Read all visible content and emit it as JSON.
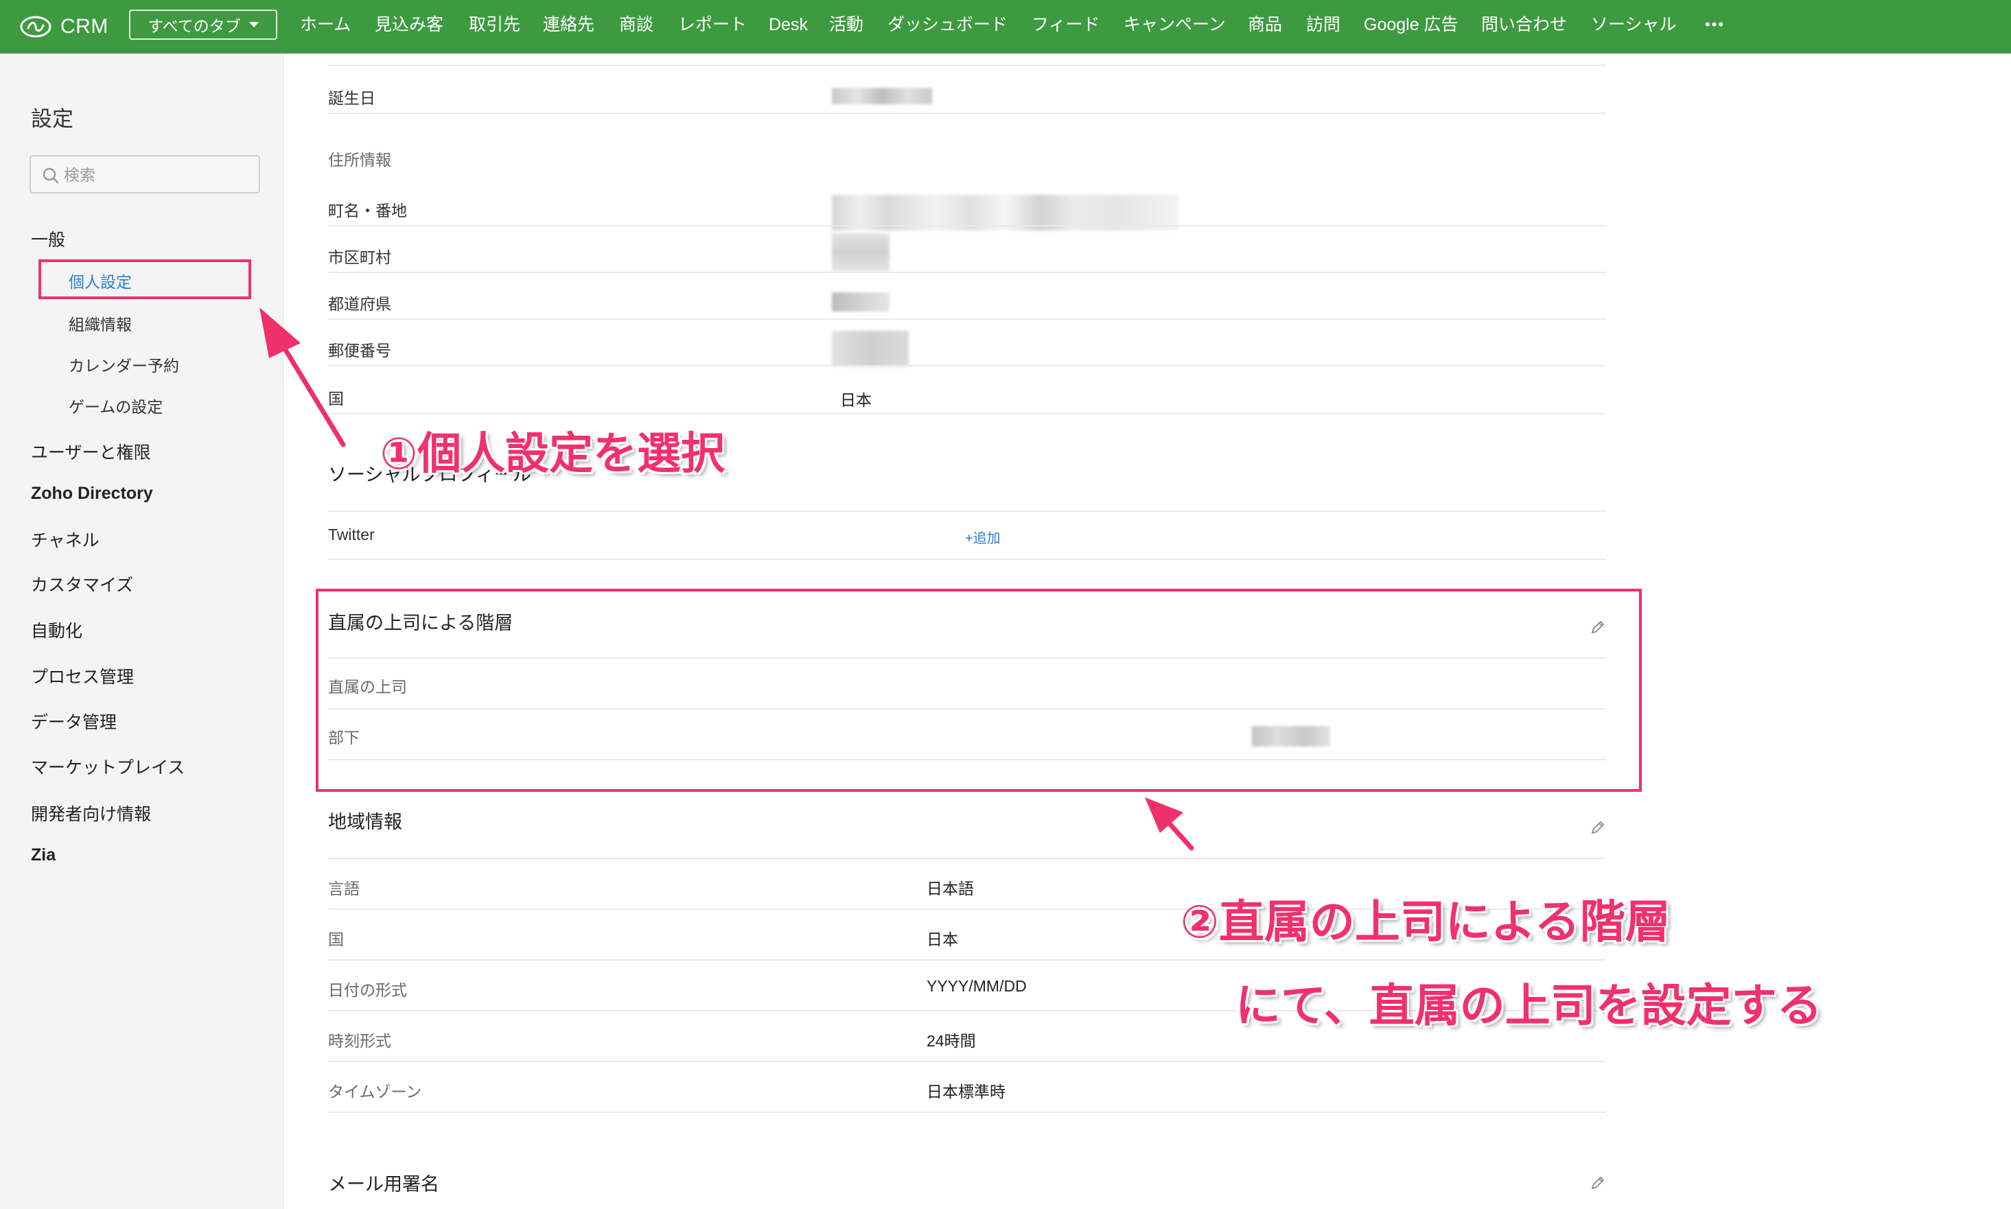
{
  "topbar": {
    "app_name": "CRM",
    "tab_selector": "すべてのタブ",
    "nav_items": [
      "ホーム",
      "見込み客",
      "取引先",
      "連絡先",
      "商談",
      "レポート",
      "Desk",
      "活動",
      "ダッシュボード",
      "フィード",
      "キャンペーン",
      "商品",
      "訪問",
      "Google 広告",
      "問い合わせ",
      "ソーシャル",
      "•••"
    ],
    "bar_color": "#3e9a40"
  },
  "sidebar": {
    "title": "設定",
    "search_placeholder": "検索",
    "general": "一般",
    "general_items": [
      "個人設定",
      "組織情報",
      "カレンダー予約",
      "ゲームの設定"
    ],
    "active_item": "個人設定",
    "sections": [
      "ユーザーと権限",
      "Zoho Directory",
      "チャネル",
      "カスタマイズ",
      "自動化",
      "プロセス管理",
      "データ管理",
      "マーケットプレイス",
      "開発者向け情報",
      "Zia"
    ]
  },
  "profile": {
    "birthday_label": "誕生日",
    "address_header": "住所情報",
    "street_label": "町名・番地",
    "city_label": "市区町村",
    "prefecture_label": "都道府県",
    "postal_label": "郵便番号",
    "country_label": "国",
    "country_value": "日本",
    "social_header": "ソーシャルプロフィール",
    "twitter_label": "Twitter",
    "add_link": "+追加"
  },
  "hierarchy": {
    "header": "直属の上司による階層",
    "manager_label": "直属の上司",
    "subordinates_label": "部下"
  },
  "locale": {
    "header": "地域情報",
    "rows": [
      {
        "label": "言語",
        "value": "日本語"
      },
      {
        "label": "国",
        "value": "日本"
      },
      {
        "label": "日付の形式",
        "value": "YYYY/MM/DD"
      },
      {
        "label": "時刻形式",
        "value": "24時間"
      },
      {
        "label": "タイムゾーン",
        "value": "日本標準時"
      }
    ]
  },
  "signature": {
    "header": "メール用署名"
  },
  "annotations": {
    "step1": "①個人設定を選択",
    "step2_line1": "②直属の上司による階層",
    "step2_line2": "にて、直属の上司を設定する",
    "color": "#f0306c"
  }
}
